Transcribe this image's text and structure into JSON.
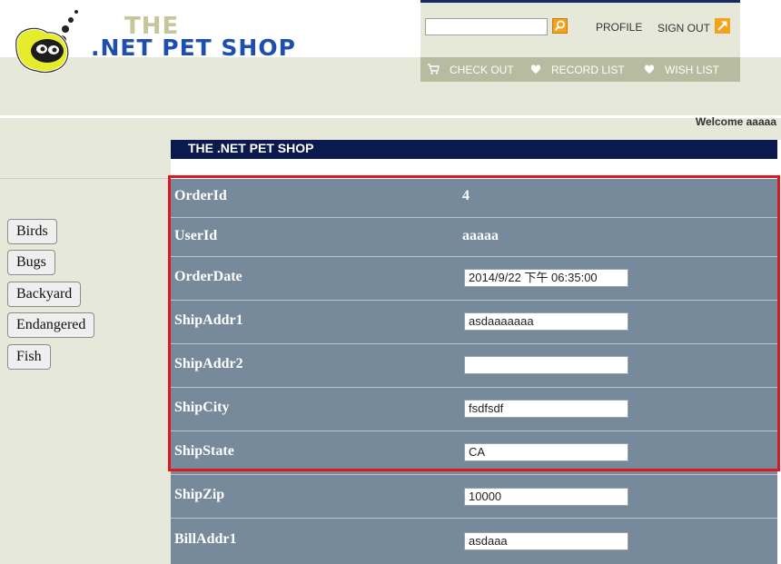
{
  "logo": {
    "the": "THE",
    "main": ".NET PET SHOP"
  },
  "search": {
    "value": "",
    "placeholder": ""
  },
  "toplinks": {
    "profile": "PROFILE",
    "signout": "SIGN OUT"
  },
  "nav": {
    "checkout": "CHECK OUT",
    "recordlist": "RECORD LIST",
    "wishlist": "WISH LIST"
  },
  "welcome": "Welcome aaaaa",
  "title": "THE .NET PET SHOP",
  "categories": [
    "Birds",
    "Bugs",
    "Backyard",
    "Endangered",
    "Fish"
  ],
  "order": [
    {
      "label": "OrderId",
      "value": "4",
      "kind": "text"
    },
    {
      "label": "UserId",
      "value": "aaaaa",
      "kind": "text"
    },
    {
      "label": "OrderDate",
      "value": "2014/9/22 下午 06:35:00",
      "kind": "input"
    },
    {
      "label": "ShipAddr1",
      "value": "asdaaaaaaa",
      "kind": "input"
    },
    {
      "label": "ShipAddr2",
      "value": "",
      "kind": "input"
    },
    {
      "label": "ShipCity",
      "value": "fsdfsdf",
      "kind": "input"
    },
    {
      "label": "ShipState",
      "value": "CA",
      "kind": "input"
    },
    {
      "label": "ShipZip",
      "value": "10000",
      "kind": "input"
    },
    {
      "label": "BillAddr1",
      "value": "asdaaa",
      "kind": "input"
    }
  ],
  "colors": {
    "accent": "#f5a21b",
    "titlebar": "#0b1a4e",
    "panel": "#768a9c",
    "highlight": "#e0171f",
    "background": "#e6e8da"
  }
}
